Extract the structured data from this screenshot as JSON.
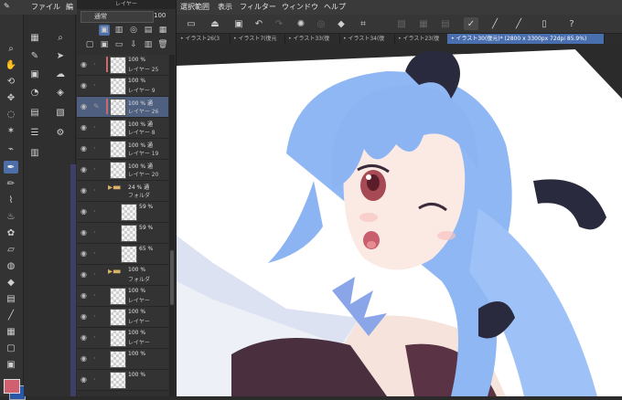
{
  "menu": [
    "ファイル",
    "編",
    "選択範囲",
    "表示",
    "フィルター",
    "ウィンドウ",
    "ヘルプ"
  ],
  "layer_panel": {
    "title": "レイヤー",
    "blend_mode": "通常",
    "opacity": "100",
    "layers": [
      {
        "pct": "100 %",
        "name": "レイヤー 25",
        "kind": "layer",
        "clip": true,
        "selected": false
      },
      {
        "pct": "100 %",
        "name": "レイヤー 9",
        "kind": "layer",
        "clip": false,
        "selected": false
      },
      {
        "pct": "100 % 通",
        "name": "レイヤー 26",
        "kind": "layer",
        "clip": true,
        "selected": true
      },
      {
        "pct": "100 % 通",
        "name": "レイヤー 8",
        "kind": "layer",
        "clip": false,
        "selected": false
      },
      {
        "pct": "100 % 通",
        "name": "レイヤー 19",
        "kind": "layer",
        "clip": false,
        "selected": false
      },
      {
        "pct": "100 % 通",
        "name": "レイヤー 20",
        "kind": "layer",
        "clip": false,
        "selected": false
      },
      {
        "pct": "24 % 通",
        "name": "フォルダ",
        "kind": "folder",
        "clip": false,
        "selected": false
      },
      {
        "pct": "59 %",
        "name": "",
        "kind": "layer",
        "clip": false,
        "selected": false
      },
      {
        "pct": "59 %",
        "name": "",
        "kind": "layer",
        "clip": false,
        "selected": false
      },
      {
        "pct": "65 %",
        "name": "",
        "kind": "layer",
        "clip": false,
        "selected": false
      },
      {
        "pct": "100 %",
        "name": "フォルダ",
        "kind": "folder",
        "clip": false,
        "selected": false
      },
      {
        "pct": "100 %",
        "name": "レイヤー",
        "kind": "layer",
        "clip": false,
        "selected": false
      },
      {
        "pct": "100 %",
        "name": "レイヤー",
        "kind": "layer",
        "clip": false,
        "selected": false
      },
      {
        "pct": "100 %",
        "name": "レイヤー",
        "kind": "layer",
        "clip": false,
        "selected": false
      },
      {
        "pct": "100 %",
        "name": "",
        "kind": "layer",
        "clip": false,
        "selected": false
      },
      {
        "pct": "100 %",
        "name": "",
        "kind": "layer",
        "clip": false,
        "selected": false
      }
    ]
  },
  "tabs": [
    {
      "label": "• イラスト26(3",
      "active": false
    },
    {
      "label": "• イラスト7(復元",
      "active": false
    },
    {
      "label": "• イラスト33(復",
      "active": false
    },
    {
      "label": "• イラスト34(復",
      "active": false
    },
    {
      "label": "• イラスト23(復",
      "active": false
    },
    {
      "label": "• イラスト30(復元)* (2800 x 3300px 72dpi 85.9%)",
      "active": true
    }
  ],
  "colors": {
    "main": "#d06070",
    "sub": "#2a58a8",
    "accent": "#4a6fae"
  }
}
